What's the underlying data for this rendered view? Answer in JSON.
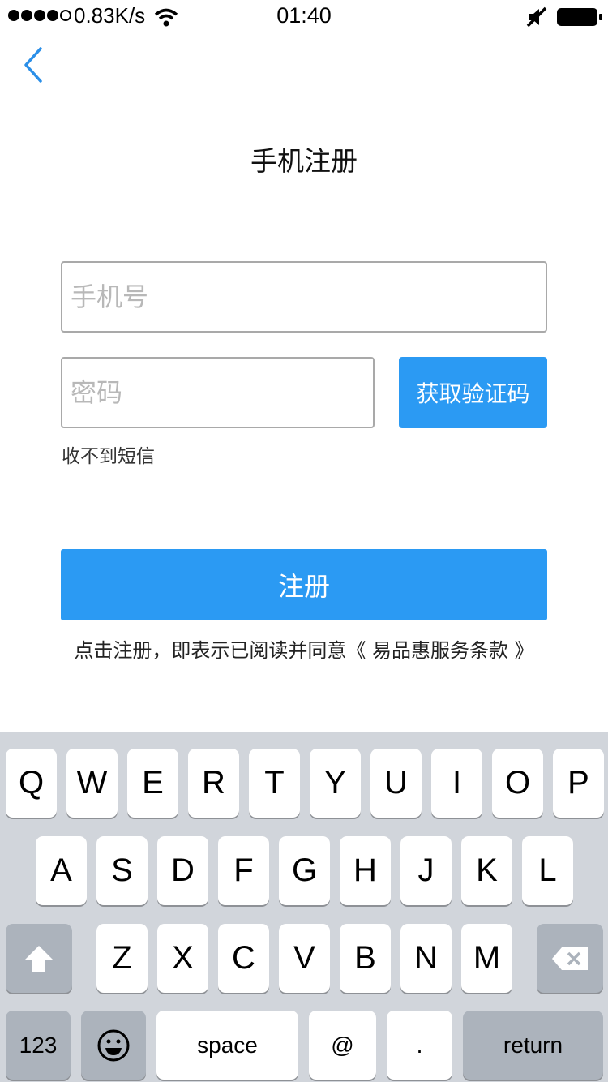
{
  "status_bar": {
    "net_speed": "0.83K/s",
    "time": "01:40",
    "icons": [
      "signal-dots-icon",
      "wifi-icon",
      "mute-icon",
      "battery-icon"
    ]
  },
  "nav": {
    "back_icon": "chevron-left-icon"
  },
  "page_title": "手机注册",
  "form": {
    "phone_placeholder": "手机号",
    "code_placeholder": "密码",
    "get_code_label": "获取验证码",
    "no_sms_label": "收不到短信",
    "register_label": "注册",
    "agreement_text": "点击注册，即表示已阅读并同意《 易品惠服务条款 》"
  },
  "keyboard": {
    "row1": [
      "Q",
      "W",
      "E",
      "R",
      "T",
      "Y",
      "U",
      "I",
      "O",
      "P"
    ],
    "row2": [
      "A",
      "S",
      "D",
      "F",
      "G",
      "H",
      "J",
      "K",
      "L"
    ],
    "row3": [
      "Z",
      "X",
      "C",
      "V",
      "B",
      "N",
      "M"
    ],
    "numbers_label": "123",
    "space_label": "space",
    "at_label": "@",
    "dot_label": ".",
    "return_label": "return",
    "shift_icon": "shift-arrow-icon",
    "delete_icon": "backspace-icon",
    "emoji_icon": "emoji-icon"
  },
  "colors": {
    "accent": "#2b9af3",
    "keyboard_bg": "#d1d5db",
    "function_key": "#acb3bc"
  }
}
